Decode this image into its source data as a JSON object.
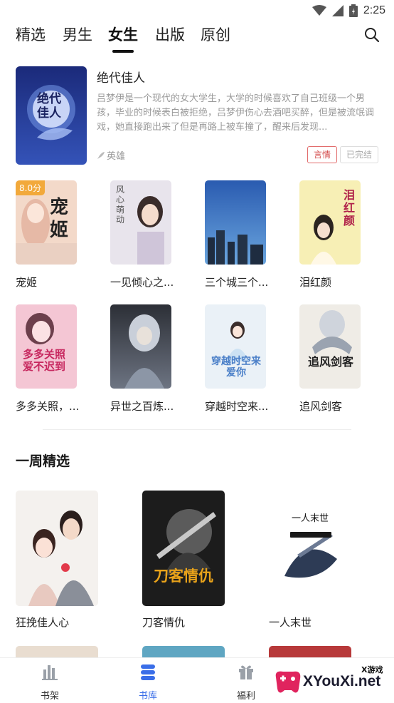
{
  "status_bar": {
    "time": "2:25",
    "icons": [
      "wifi-icon",
      "signal-icon",
      "battery-icon"
    ]
  },
  "tabs": [
    {
      "label": "精选",
      "active": false
    },
    {
      "label": "男生",
      "active": false
    },
    {
      "label": "女生",
      "active": true
    },
    {
      "label": "出版",
      "active": false
    },
    {
      "label": "原创",
      "active": false
    }
  ],
  "featured": {
    "title": "绝代佳人",
    "cover_text": "绝代佳人",
    "description": "吕梦伊是一个现代的女大学生，大学的时候喜欢了自己班级一个男孩，毕业的时候表白被拒绝，吕梦伊伤心去酒吧买醉，但是被流氓调戏，她直接跑出来了但是再路上被车撞了，醒来后发现...",
    "author": "英雄",
    "tags": [
      "言情",
      "已完结"
    ]
  },
  "grid_books": [
    {
      "title": "宠姬",
      "score": "8.0分",
      "cover_text": "宠姬",
      "cover_color": "#f3d9c9"
    },
    {
      "title": "一见倾心之...",
      "cover_text": "风心萌动",
      "cover_color": "#e8e4ec"
    },
    {
      "title": "三个城三个...",
      "cover_text": "",
      "cover_color": "#2f5c93"
    },
    {
      "title": "泪红颜",
      "cover_text": "泪红颜",
      "cover_color": "#f7efb5"
    },
    {
      "title": "多多关照，...",
      "cover_text": "多多关照 爱不迟到",
      "cover_color": "#f4c6d4"
    },
    {
      "title": "异世之百炼...",
      "cover_text": "",
      "cover_color": "#4b4f58"
    },
    {
      "title": "穿越时空来...",
      "cover_text": "穿越时空来爱你",
      "cover_color": "#eaf1f7"
    },
    {
      "title": "追风剑客",
      "cover_text": "追风剑客",
      "cover_color": "#efece6"
    }
  ],
  "section": {
    "title": "一周精选"
  },
  "weekly_books": [
    {
      "title": "狂挽佳人心",
      "cover_text": "",
      "cover_color": "#f4f1ee"
    },
    {
      "title": "刀客情仇",
      "cover_text": "刀客情仇",
      "cover_color": "#1c1c1c"
    },
    {
      "title": "一人末世",
      "cover_text": "一人末世",
      "cover_color": "#ffffff"
    }
  ],
  "bottom_nav": [
    {
      "label": "书架",
      "icon": "bookshelf-icon",
      "active": false
    },
    {
      "label": "书库",
      "icon": "library-icon",
      "active": true
    },
    {
      "label": "福利",
      "icon": "gift-icon",
      "active": false
    }
  ],
  "watermark": {
    "text": "XYouXi.net",
    "small": "X游戏"
  },
  "colors": {
    "accent": "#3a6ee8",
    "tag_red": "#d34a4a",
    "badge": "#f2a93b"
  }
}
